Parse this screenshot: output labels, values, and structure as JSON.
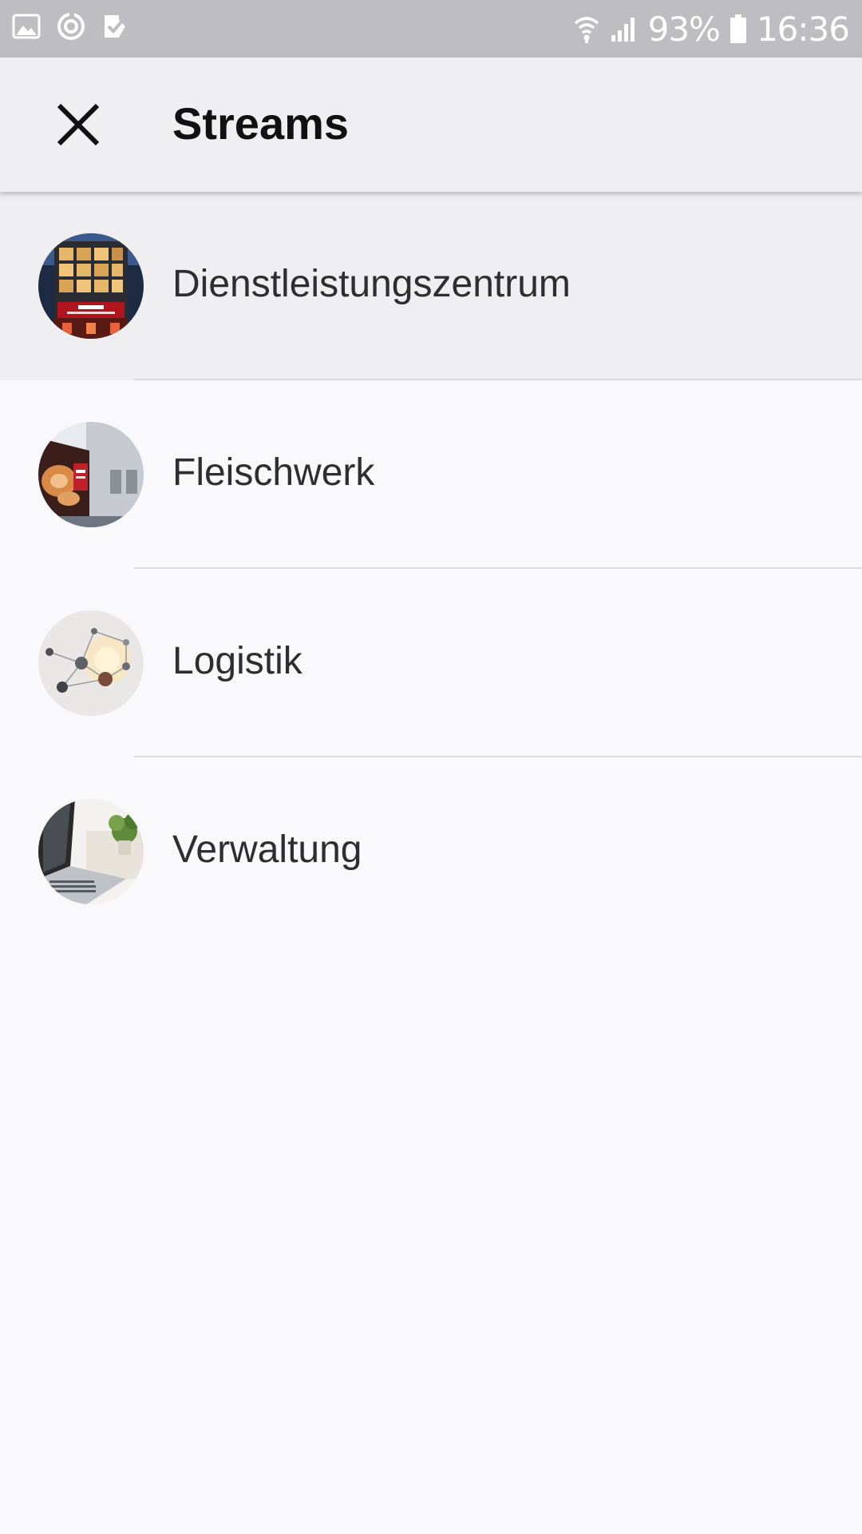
{
  "status_bar": {
    "battery": "93%",
    "time": "16:36",
    "icons": [
      "gallery-icon",
      "sync-icon",
      "check-app-icon",
      "wifi-icon",
      "signal-icon",
      "battery-icon"
    ]
  },
  "app_bar": {
    "title": "Streams",
    "close_icon": "close-icon"
  },
  "streams": [
    {
      "label": "Dienstleistungszentrum",
      "selected": true,
      "avatar": "building-photo"
    },
    {
      "label": "Fleischwerk",
      "selected": false,
      "avatar": "meat-factory-photo"
    },
    {
      "label": "Logistik",
      "selected": false,
      "avatar": "network-photo"
    },
    {
      "label": "Verwaltung",
      "selected": false,
      "avatar": "laptop-desk-photo"
    }
  ],
  "colors": {
    "status_bar_bg": "#bebdc1",
    "app_bar_bg": "#efeef0",
    "page_bg": "#f9f8fa",
    "selected_row_bg": "#efeef0",
    "divider": "#dcdbdd",
    "text": "#2e2d31"
  }
}
